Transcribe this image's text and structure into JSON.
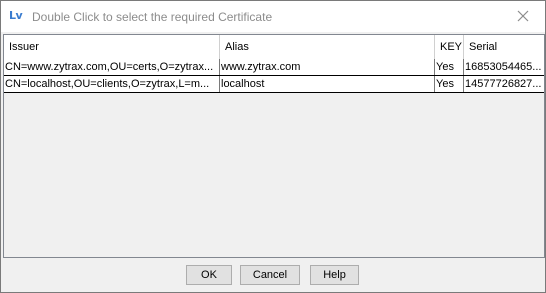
{
  "window": {
    "icon_text": "Lv",
    "title": "Double Click to select the required Certificate"
  },
  "table": {
    "columns": [
      "Issuer",
      "Alias",
      "KEY",
      "Serial"
    ],
    "rows": [
      {
        "issuer": "CN=www.zytrax.com,OU=certs,O=zytrax...",
        "alias": "www.zytrax.com",
        "key": "Yes",
        "serial": "16853054465..."
      },
      {
        "issuer": "CN=localhost,OU=clients,O=zytrax,L=m...",
        "alias": "localhost",
        "key": "Yes",
        "serial": "14577726827..."
      }
    ]
  },
  "buttons": {
    "ok": "OK",
    "cancel": "Cancel",
    "help": "Help"
  },
  "colors": {
    "accent": "#3a7ccf",
    "title_text": "#8c8c8c",
    "button_face": "#e1e1e1"
  }
}
